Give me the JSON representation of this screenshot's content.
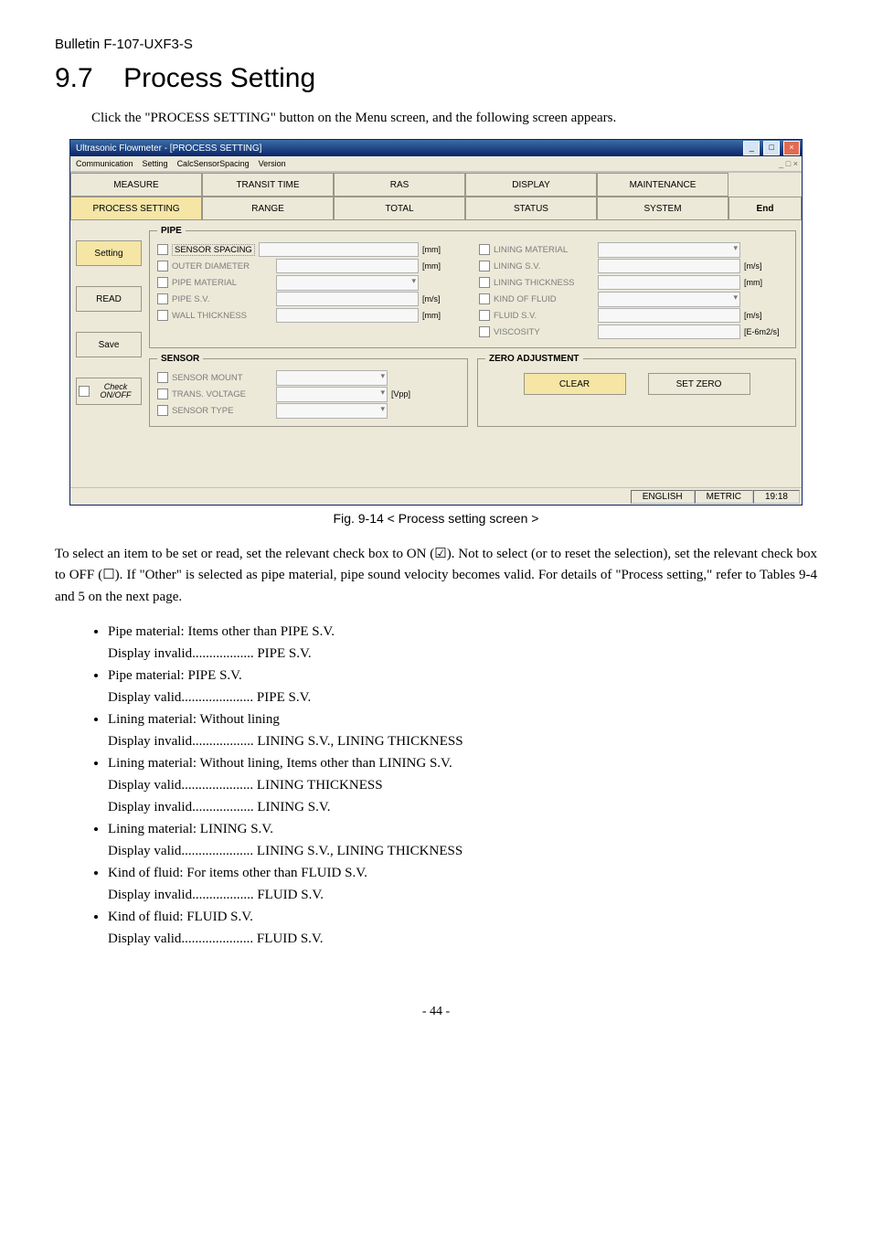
{
  "bulletin": "Bulletin F-107-UXF3-S",
  "section_no": "9.7",
  "section_title": "Process Setting",
  "lead": "Click the \"PROCESS SETTING\" button on the Menu screen, and the following screen appears.",
  "fig_caption": "Fig. 9-14 < Process setting screen >",
  "para1": "To select an item to be set or read, set the relevant check box to ON (☑).   Not to select (or to reset the selection), set the relevant check box to OFF (☐).   If \"Other\" is selected as pipe material, pipe sound velocity becomes valid. For details of \"Process setting,\" refer to Tables 9-4 and 5 on the next page.",
  "bullets": [
    "Pipe material: Items other than PIPE S.V.",
    "Display invalid.................. PIPE S.V.",
    "Pipe material: PIPE S.V.",
    "Display valid..................... PIPE S.V.",
    "Lining material: Without lining",
    "Display invalid.................. LINING S.V., LINING THICKNESS",
    "Lining material: Without lining, Items other than LINING S.V.",
    "Display valid..................... LINING THICKNESS",
    "Display invalid.................. LINING S.V.",
    "Lining material: LINING S.V.",
    "Display valid..................... LINING S.V., LINING THICKNESS",
    "Kind of fluid: For items other than FLUID S.V.",
    "Display invalid.................. FLUID S.V.",
    "Kind of fluid: FLUID S.V.",
    "Display valid..................... FLUID S.V."
  ],
  "pageno": "- 44 -",
  "app": {
    "title": "Ultrasonic Flowmeter - [PROCESS SETTING]",
    "menus": [
      "Communication",
      "Setting",
      "CalcSensorSpacing",
      "Version"
    ],
    "child_ctrl": "_  □  ×",
    "tabs_row1": [
      "MEASURE",
      "TRANSIT TIME",
      "RAS",
      "DISPLAY",
      "MAINTENANCE"
    ],
    "tabs_row2": [
      "PROCESS SETTING",
      "RANGE",
      "TOTAL",
      "STATUS",
      "SYSTEM"
    ],
    "end": "End",
    "side": {
      "setting": "Setting",
      "read": "READ",
      "save": "Save",
      "check": "Check ON/OFF"
    },
    "pipe": {
      "legend": "PIPE",
      "left": [
        {
          "label": "SENSOR SPACING",
          "unit": "[mm]",
          "selected": true
        },
        {
          "label": "OUTER DIAMETER",
          "unit": "[mm]"
        },
        {
          "label": "PIPE MATERIAL",
          "dropdown": true
        },
        {
          "label": "PIPE S.V.",
          "unit": "[m/s]"
        },
        {
          "label": "WALL THICKNESS",
          "unit": "[mm]"
        }
      ],
      "right": [
        {
          "label": "LINING MATERIAL",
          "dropdown": true
        },
        {
          "label": "LINING S.V.",
          "unit": "[m/s]"
        },
        {
          "label": "LINING THICKNESS",
          "unit": "[mm]"
        },
        {
          "label": "KIND OF FLUID",
          "dropdown": true
        },
        {
          "label": "FLUID S.V.",
          "unit": "[m/s]"
        },
        {
          "label": "VISCOSITY",
          "unit": "[E-6m2/s]"
        }
      ]
    },
    "sensor": {
      "legend": "SENSOR",
      "rows": [
        {
          "label": "SENSOR MOUNT",
          "dropdown": true
        },
        {
          "label": "TRANS. VOLTAGE",
          "dropdown": true,
          "unit": "[Vpp]"
        },
        {
          "label": "SENSOR TYPE",
          "dropdown": true
        }
      ]
    },
    "zero": {
      "legend": "ZERO ADJUSTMENT",
      "clear": "CLEAR",
      "setzero": "SET ZERO"
    },
    "status": {
      "lang": "ENGLISH",
      "unit": "METRIC",
      "time": "19:18"
    }
  }
}
